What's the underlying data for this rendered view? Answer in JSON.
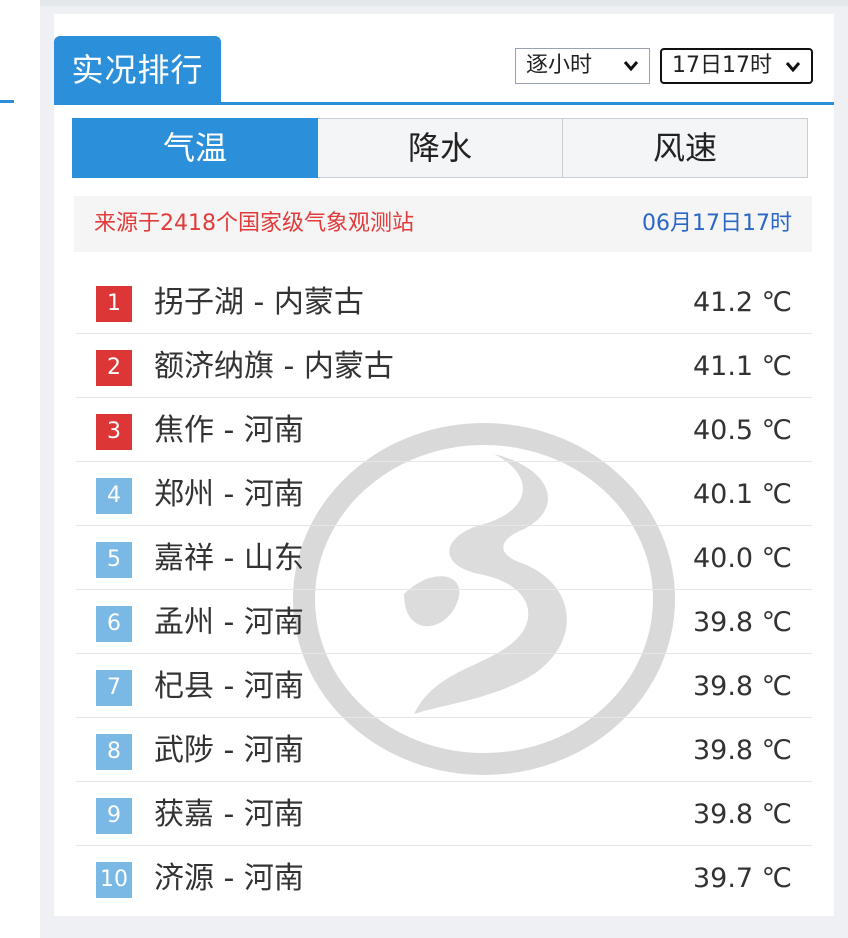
{
  "header": {
    "title": "实况排行"
  },
  "controls": {
    "mode_select": "逐小时",
    "time_select": "17日17时"
  },
  "tabs": [
    {
      "label": "气温",
      "active": true
    },
    {
      "label": "降水",
      "active": false
    },
    {
      "label": "风速",
      "active": false
    }
  ],
  "source": {
    "text": "来源于2418个国家级气象观测站",
    "time": "06月17日17时"
  },
  "ranking": [
    {
      "rank": "1",
      "place": "拐子湖 - 内蒙古",
      "temp": "41.2 ℃"
    },
    {
      "rank": "2",
      "place": "额济纳旗 - 内蒙古",
      "temp": "41.1 ℃"
    },
    {
      "rank": "3",
      "place": "焦作 - 河南",
      "temp": "40.5 ℃"
    },
    {
      "rank": "4",
      "place": "郑州 - 河南",
      "temp": "40.1 ℃"
    },
    {
      "rank": "5",
      "place": "嘉祥 - 山东",
      "temp": "40.0 ℃"
    },
    {
      "rank": "6",
      "place": "孟州 - 河南",
      "temp": "39.8 ℃"
    },
    {
      "rank": "7",
      "place": "杞县 - 河南",
      "temp": "39.8 ℃"
    },
    {
      "rank": "8",
      "place": "武陟 - 河南",
      "temp": "39.8 ℃"
    },
    {
      "rank": "9",
      "place": "获嘉 - 河南",
      "temp": "39.8 ℃"
    },
    {
      "rank": "10",
      "place": "济源 - 河南",
      "temp": "39.7 ℃"
    }
  ],
  "colors": {
    "accent": "#2b8fd9",
    "top_rank": "#dd3636",
    "other_rank": "#7ab8e6",
    "source_text": "#e23b3b",
    "source_time": "#2a67c6"
  },
  "icons": {
    "select_arrow": "chevron-down-icon",
    "watermark": "logo-watermark-icon"
  }
}
